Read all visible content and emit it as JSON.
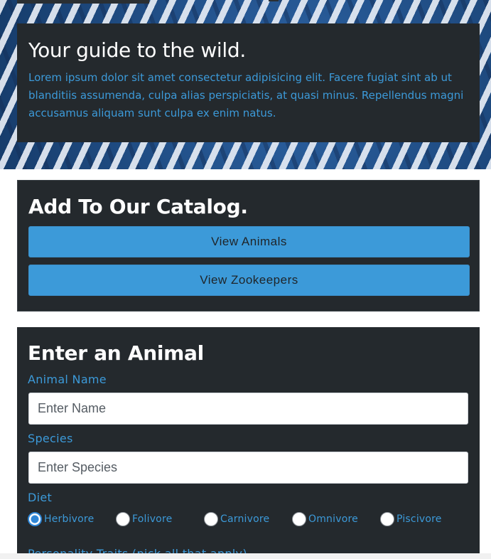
{
  "hero": {
    "title": "Your guide to the wild.",
    "text": "Lorem ipsum dolor sit amet consectetur adipisicing elit. Facere fugiat sint ab ut blanditiis assumenda, culpa alias perspiciatis, at quasi minus. Repellendus magni accusamus aliquam sunt culpa ex enim natus."
  },
  "catalog": {
    "title": "Add To Our Catalog.",
    "view_animals_label": "View Animals",
    "view_zookeepers_label": "View Zookeepers"
  },
  "enter_animal": {
    "title": "Enter an Animal",
    "name_label": "Animal Name",
    "name_placeholder": "Enter Name",
    "species_label": "Species",
    "species_placeholder": "Enter Species",
    "diet_label": "Diet",
    "diet_options": [
      "Herbivore",
      "Folivore",
      "Carnivore",
      "Omnivore",
      "Piscivore"
    ],
    "diet_selected": "Herbivore",
    "traits_label": "Personality Traits (pick all that apply)"
  },
  "colors": {
    "panel_bg": "#24292d",
    "accent": "#3c9ad9",
    "heading": "#ffffff"
  }
}
